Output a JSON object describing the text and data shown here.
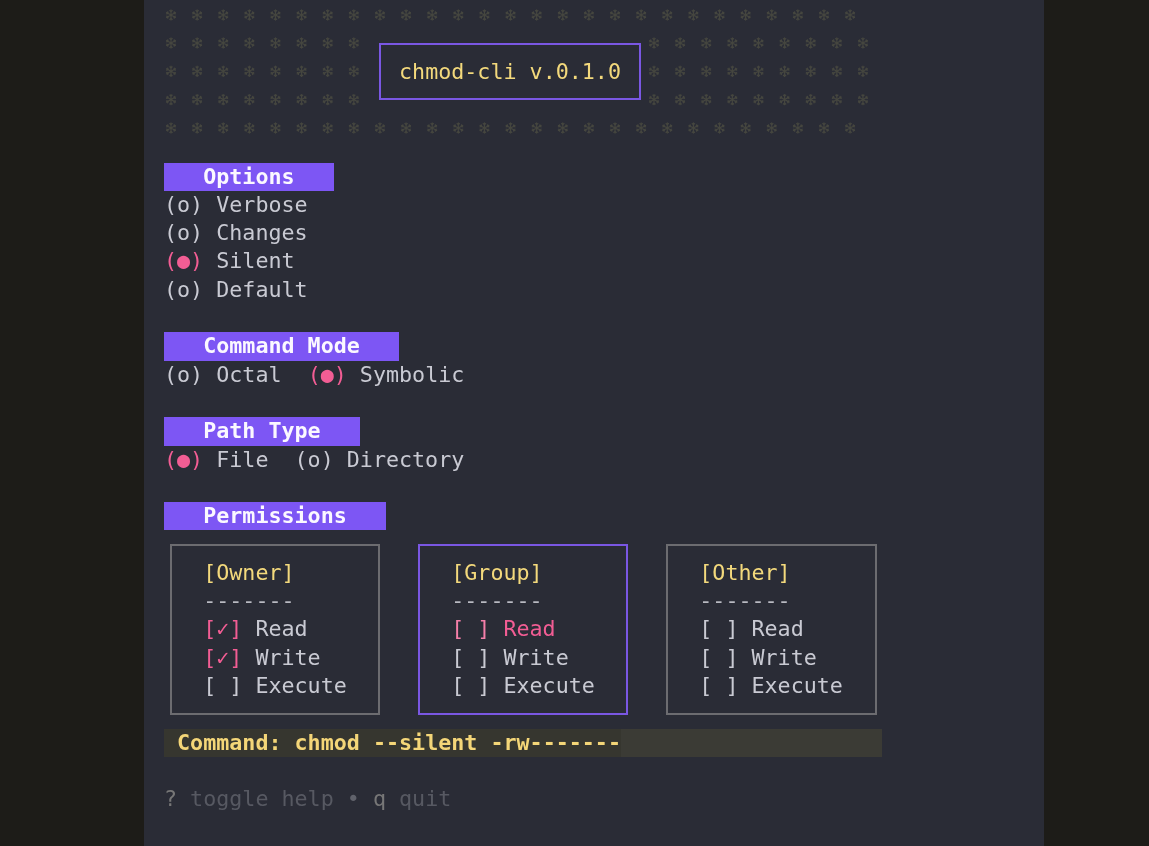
{
  "app": {
    "title": "chmod-cli v.0.1.0"
  },
  "sections": [
    {
      "kind": "radio-column",
      "title": "Options",
      "items": [
        {
          "mark": "(o)",
          "label": "Verbose",
          "selected": false
        },
        {
          "mark": "(o)",
          "label": "Changes",
          "selected": false
        },
        {
          "mark": "(●)",
          "label": "Silent",
          "selected": true
        },
        {
          "mark": "(o)",
          "label": "Default",
          "selected": false
        }
      ]
    },
    {
      "kind": "radio-row",
      "title": "Command Mode",
      "items": [
        {
          "mark": "(o)",
          "label": "Octal",
          "selected": false
        },
        {
          "mark": "(●)",
          "label": "Symbolic",
          "selected": true
        }
      ]
    },
    {
      "kind": "radio-row",
      "title": "Path Type",
      "items": [
        {
          "mark": "(●)",
          "label": "File",
          "selected": true
        },
        {
          "mark": "(o)",
          "label": "Directory",
          "selected": false
        }
      ]
    },
    {
      "kind": "permissions",
      "title": "Permissions",
      "groups": [
        {
          "title": "[Owner]",
          "rule": "-------",
          "selected": false,
          "items": [
            {
              "mark": "[✓]",
              "label": "Read",
              "checked": true,
              "selected": false
            },
            {
              "mark": "[✓]",
              "label": "Write",
              "checked": true,
              "selected": false
            },
            {
              "mark": "[ ]",
              "label": "Execute",
              "checked": false,
              "selected": false
            }
          ]
        },
        {
          "title": "[Group]",
          "rule": "-------",
          "selected": true,
          "items": [
            {
              "mark": "[ ]",
              "label": "Read",
              "checked": false,
              "selected": true
            },
            {
              "mark": "[ ]",
              "label": "Write",
              "checked": false,
              "selected": false
            },
            {
              "mark": "[ ]",
              "label": "Execute",
              "checked": false,
              "selected": false
            }
          ]
        },
        {
          "title": "[Other]",
          "rule": "-------",
          "selected": false,
          "items": [
            {
              "mark": "[ ]",
              "label": "Read",
              "checked": false,
              "selected": false
            },
            {
              "mark": "[ ]",
              "label": "Write",
              "checked": false,
              "selected": false
            },
            {
              "mark": "[ ]",
              "label": "Execute",
              "checked": false,
              "selected": false
            }
          ]
        }
      ]
    }
  ],
  "command": {
    "text": "Command: chmod --silent -rw-------"
  },
  "help": {
    "separator": "•",
    "items": [
      {
        "key": "?",
        "description": "toggle help"
      },
      {
        "key": "q",
        "description": "quit"
      }
    ]
  }
}
